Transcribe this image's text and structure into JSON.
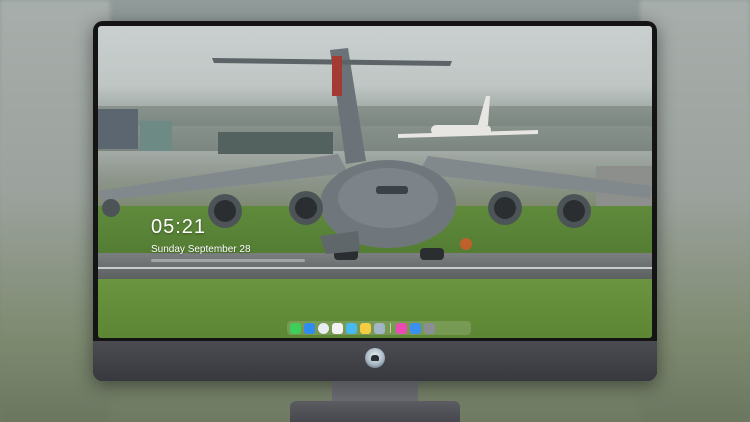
{
  "lock_screen": {
    "time": "05:21",
    "date": "Sunday September  28"
  },
  "dock": {
    "items": [
      {
        "name": "messages-icon",
        "color": "#3ecf5a"
      },
      {
        "name": "finder-icon",
        "color": "#2f8cf0"
      },
      {
        "name": "safari-icon",
        "color": "#e8edf2"
      },
      {
        "name": "photos-icon",
        "color": "#f2f2f2"
      },
      {
        "name": "clips-icon",
        "color": "#47b9f0"
      },
      {
        "name": "notes-icon",
        "color": "#f5cd44"
      },
      {
        "name": "preview-icon",
        "color": "#a3b6c6"
      },
      {
        "name": "itunes-icon",
        "color": "#ea4ab2"
      },
      {
        "name": "app-store-icon",
        "color": "#3a8ff0"
      },
      {
        "name": "camera-icon",
        "color": "#8a8f94"
      }
    ]
  },
  "monitor": {
    "logo": "alien-logo-icon"
  }
}
